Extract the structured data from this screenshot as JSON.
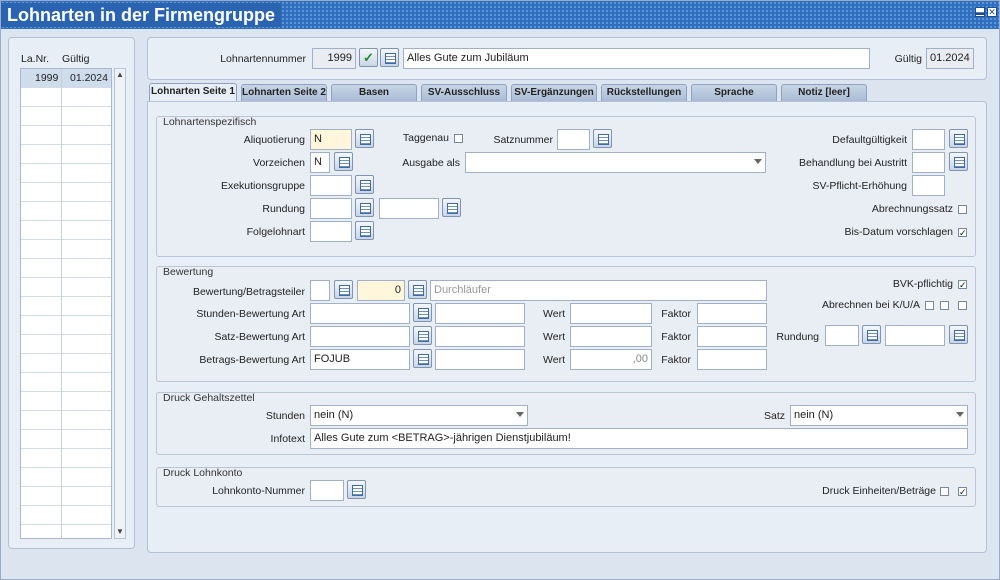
{
  "window": {
    "title": "Lohnarten in der Firmengruppe"
  },
  "list": {
    "headers": [
      "La.Nr.",
      "Gültig"
    ],
    "rows": [
      {
        "nr": "1999",
        "gueltig": "01.2024"
      }
    ]
  },
  "header": {
    "nummer_label": "Lohnartennummer",
    "nummer_value": "1999",
    "bezeichnung_value": "Alles Gute zum Jubiläum",
    "gueltig_label": "Gültig",
    "gueltig_value": "01.2024"
  },
  "tabs": [
    "Lohnarten Seite 1",
    "Lohnarten Seite 2",
    "Basen",
    "SV-Ausschluss",
    "SV-Ergänzungen",
    "Rückstellungen",
    "Sprache",
    "Notiz [leer]"
  ],
  "lohnartenspezifisch": {
    "title": "Lohnartenspezifisch",
    "aliquotierung_label": "Aliquotierung",
    "aliquotierung_value": "N",
    "vorzeichen_label": "Vorzeichen",
    "vorzeichen_value": "N",
    "exekutionsgruppe_label": "Exekutionsgruppe",
    "rundung_label": "Rundung",
    "folgelohnart_label": "Folgelohnart",
    "taggenau_label": "Taggenau",
    "satznummer_label": "Satznummer",
    "ausgabe_label": "Ausgabe als",
    "defaultgueltigkeit_label": "Defaultgültigkeit",
    "behandlung_label": "Behandlung bei Austritt",
    "svpflicht_label": "SV-Pflicht-Erhöhung",
    "abrechnungssatz_label": "Abrechnungssatz",
    "bisdatum_label": "Bis-Datum vorschlagen",
    "bisdatum_checked": "✓"
  },
  "bewertung": {
    "title": "Bewertung",
    "betragsteiler_label": "Bewertung/Betragsteiler",
    "betragsteiler_value": "0",
    "durchlaeufer_value": "Durchläufer",
    "stunden_label": "Stunden-Bewertung Art",
    "satz_label": "Satz-Bewertung Art",
    "betrags_label": "Betrags-Bewertung Art",
    "betrags_value": "FOJUB",
    "wert_label": "Wert",
    "faktor_label": "Faktor",
    "wert3_value": ",00",
    "bvk_label": "BVK-pflichtig",
    "bvk_checked": "✓",
    "kua_label": "Abrechnen bei K/U/A",
    "rundung_label": "Rundung"
  },
  "druck_gehaltszettel": {
    "title": "Druck Gehaltszettel",
    "stunden_label": "Stunden",
    "stunden_value": "nein (N)",
    "satz_label": "Satz",
    "satz_value": "nein (N)",
    "infotext_label": "Infotext",
    "infotext_value": "Alles Gute zum <BETRAG>-jährigen Dienstjubiläum!"
  },
  "druck_lohnkonto": {
    "title": "Druck Lohnkonto",
    "nummer_label": "Lohnkonto-Nummer",
    "einheiten_label": "Druck Einheiten/Beträge",
    "einheiten_checked": "✓"
  },
  "colors": {
    "titlebar": "#2f6fbd",
    "panel": "#e8eef6",
    "highlight": "#fff6dc"
  }
}
